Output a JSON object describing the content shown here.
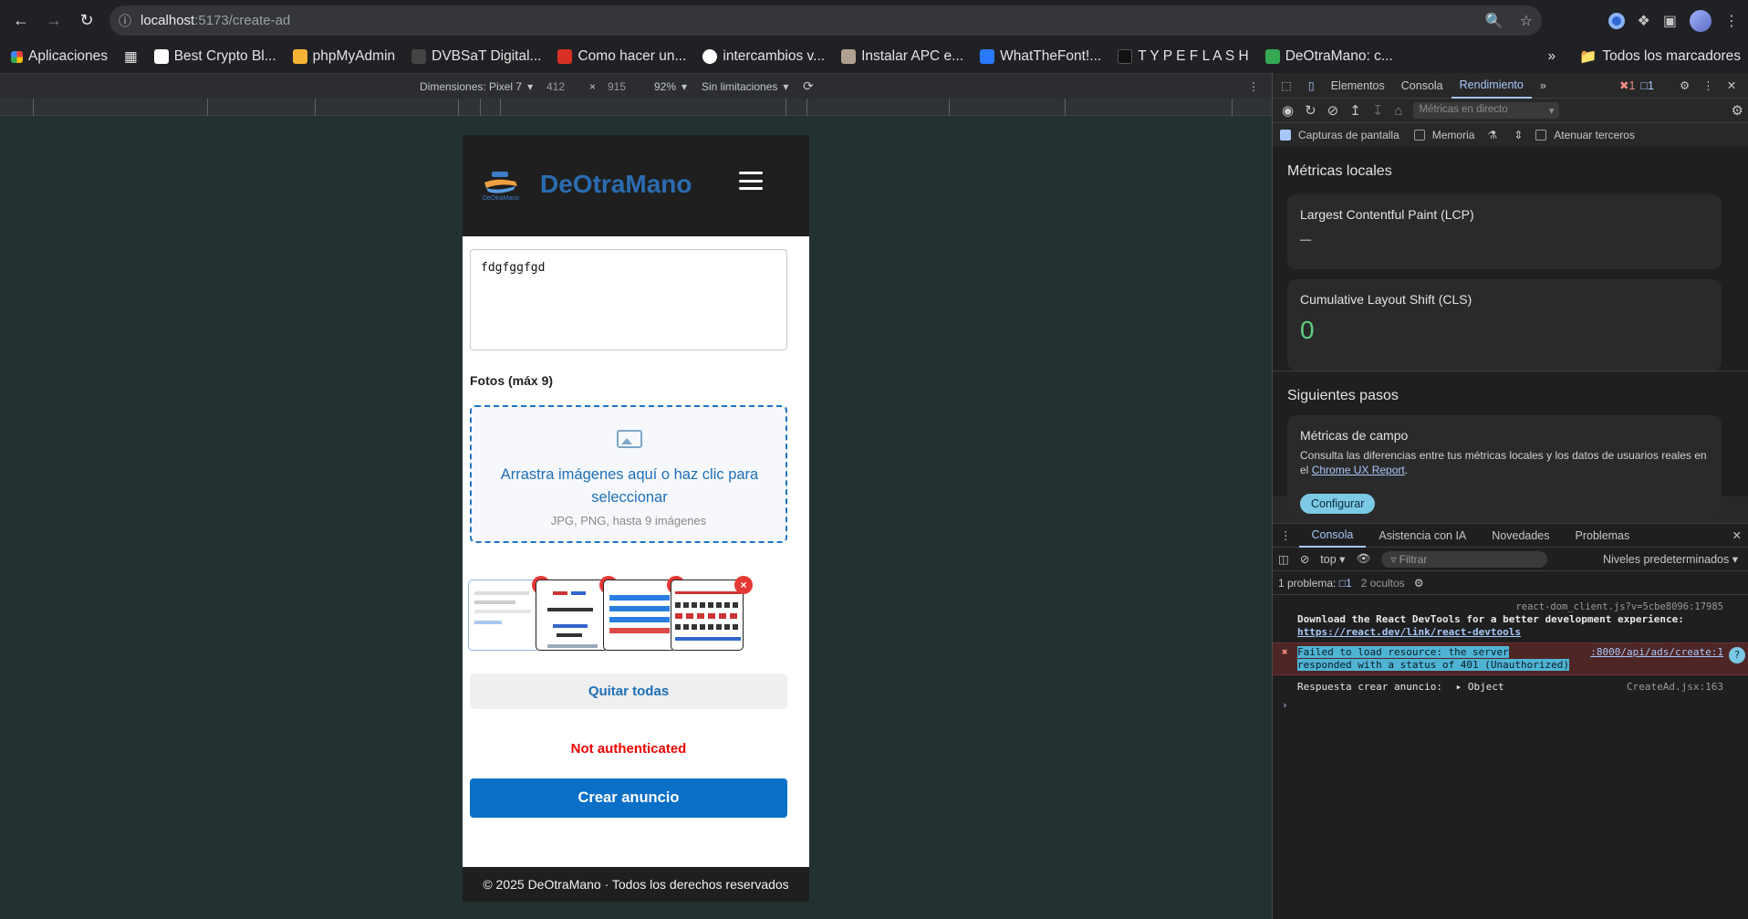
{
  "browser": {
    "url_host": "localhost",
    "url_path": ":5173/create-ad",
    "bookmarks": [
      {
        "label": "Aplicaciones",
        "color": "#e94235"
      },
      {
        "label": "Best Crypto Bl...",
        "color": "#ffffff"
      },
      {
        "label": "phpMyAdmin",
        "color": "#f5b335"
      },
      {
        "label": "DVBSaT Digital...",
        "color": "#222222"
      },
      {
        "label": "Como hacer un...",
        "color": "#d93025"
      },
      {
        "label": "intercambios v...",
        "color": "#4285f4"
      },
      {
        "label": "Instalar APC e...",
        "color": "#b0a090"
      },
      {
        "label": "WhatTheFont!...",
        "color": "#2979ff"
      },
      {
        "label": "T Y P E F L A S H",
        "color": "#111111"
      },
      {
        "label": "DeOtraMano: c...",
        "color": "#34a853"
      }
    ],
    "all_bookmarks": "Todos los marcadores"
  },
  "device_toolbar": {
    "dimensions_label": "Dimensiones: Pixel 7",
    "width": "412",
    "times": "×",
    "height": "915",
    "zoom": "92%",
    "throttle": "Sin limitaciones"
  },
  "page": {
    "brand": "DeOtraMano",
    "logo_text": "DeOtraMano",
    "textarea_value": "fdgfggfgd",
    "photos_label": "Fotos (máx 9)",
    "dropzone_text": "Arrastra imágenes aquí o haz clic para seleccionar",
    "dropzone_hint": "JPG, PNG, hasta 9 imágenes",
    "remove_symbol": "×",
    "clear_all": "Quitar todas",
    "error": "Not authenticated",
    "submit": "Crear anuncio",
    "footer": "© 2025 DeOtraMano · Todos los derechos reservados",
    "thumbnail_count": 4
  },
  "devtools": {
    "tabs": [
      "Elementos",
      "Consola",
      "Rendimiento"
    ],
    "active_tab": "Rendimiento",
    "error_count": "1",
    "message_count": "1",
    "live_metrics": "Métricas en directo",
    "screenshots": "Capturas de pantalla",
    "memory": "Memoria",
    "third_party": "Atenuar terceros",
    "local_metrics_title": "Métricas locales",
    "lcp_title": "Largest Contentful Paint (LCP)",
    "lcp_value": "–",
    "cls_title": "Cumulative Layout Shift (CLS)",
    "cls_value": "0",
    "next_steps_title": "Siguientes pasos",
    "field_title": "Métricas de campo",
    "field_desc": "Consulta las diferencias entre tus métricas locales y los datos de usuarios reales en el",
    "field_link": "Chrome UX Report",
    "configure": "Configurar",
    "console_tabs": [
      "Consola",
      "Asistencia con IA",
      "Novedades",
      "Problemas"
    ],
    "context": "top",
    "filter": "Filtrar",
    "levels": "Niveles predeterminados",
    "issues": "1 problema:",
    "issues_count": "1",
    "hidden": "2 ocultos",
    "log1_src": "react-dom_client.js?v=5cbe8096:17985",
    "log1_text": "Download the React DevTools for a better development experience:",
    "log1_link": "https://react.dev/link/react-devtools",
    "log2_src": ":8000/api/ads/create:1",
    "log2_line1": "Failed to load resource: the server",
    "log2_line2": "responded with a status of 401 (Unauthorized)",
    "log3_text": "Respuesta crear anuncio:",
    "log3_obj": "Object",
    "log3_src": "CreateAd.jsx:163"
  },
  "colors": {
    "brand_blue": "#2b6cb0",
    "primary_button": "#0a6fc7",
    "error_red": "#ee0000",
    "devtools_accent": "#a8c7fa"
  }
}
